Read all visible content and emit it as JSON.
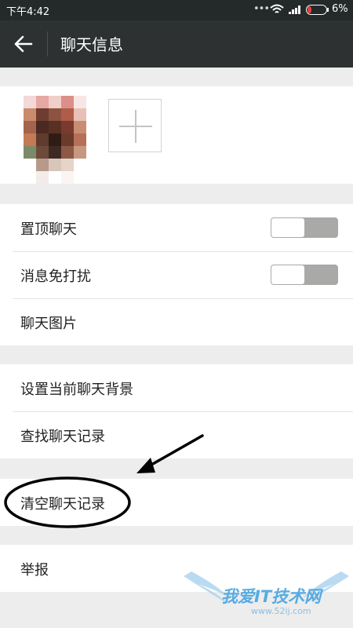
{
  "status_bar": {
    "time": "下午4:42",
    "dots": "•••",
    "battery": "6%"
  },
  "header": {
    "title": "聊天信息"
  },
  "settings": {
    "pin_chat": {
      "label": "置顶聊天",
      "enabled": false
    },
    "mute": {
      "label": "消息免打扰",
      "enabled": false
    },
    "chat_images": {
      "label": "聊天图片"
    },
    "set_background": {
      "label": "设置当前聊天背景"
    },
    "search_history": {
      "label": "查找聊天记录"
    },
    "clear_history": {
      "label": "清空聊天记录"
    },
    "report": {
      "label": "举报"
    }
  },
  "watermark": {
    "text": "我爱IT技术网",
    "url": "www.52ij.com"
  },
  "colors": {
    "title_bar": "#2e3132",
    "status_bar": "#24292a",
    "page_bg": "#ededed",
    "toggle_off": "#a9aaa8",
    "annotation": "#000000"
  }
}
